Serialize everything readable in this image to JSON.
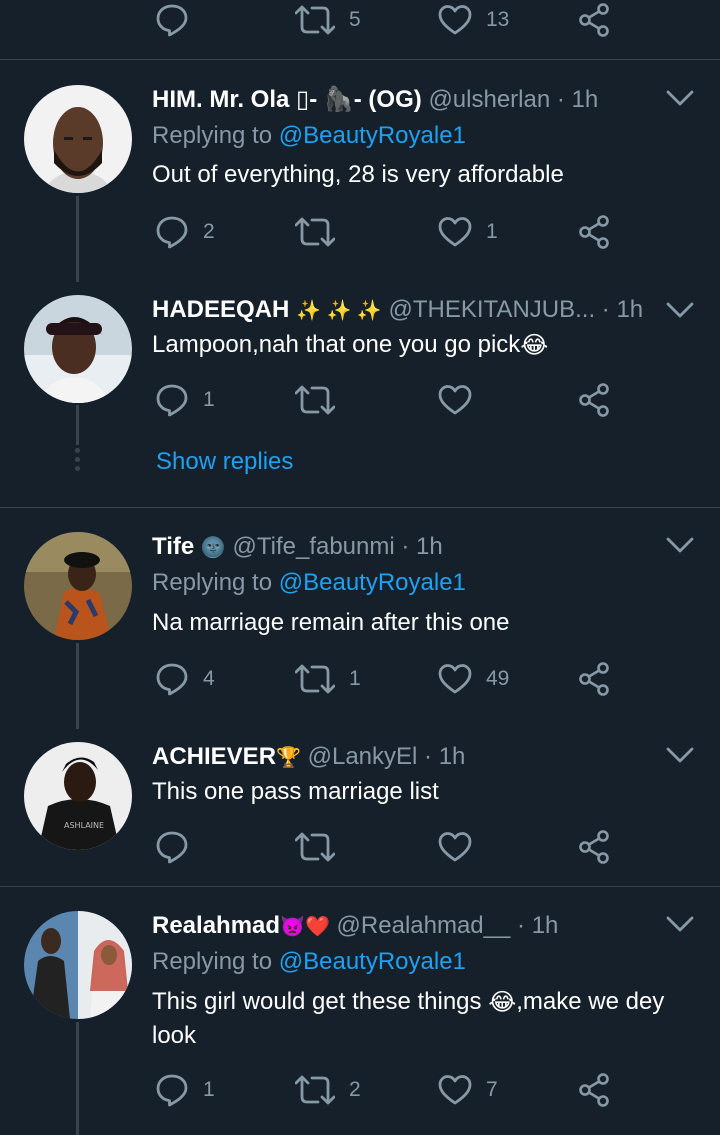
{
  "top_actions": {
    "retweets": "5",
    "likes": "13"
  },
  "tweets": [
    {
      "name": "HIM. Mr. Ola ▯- 🦍- (OG)",
      "handle": "@ulsherlan",
      "time": "· 1h",
      "replying_prefix": "Replying to ",
      "replying_to": "@BeautyRoyale1",
      "text": "Out of everything, 28 is very affordable",
      "replies": "2",
      "retweets": "",
      "likes": "1"
    },
    {
      "name": "HADEEQAH",
      "name_emoji": "✨ ✨ ✨",
      "handle": "@THEKITANJUB...",
      "time": "· 1h",
      "text": "Lampoon,nah that one you go pick",
      "text_emoji": "😂",
      "replies": "1",
      "retweets": "",
      "likes": "",
      "show_replies": "Show replies"
    },
    {
      "name": "Tife",
      "name_emoji": "🌚",
      "handle": "@Tife_fabunmi",
      "time": "· 1h",
      "replying_prefix": "Replying to ",
      "replying_to": "@BeautyRoyale1",
      "text": "Na marriage remain after this one",
      "replies": "4",
      "retweets": "1",
      "likes": "49"
    },
    {
      "name": "ACHIEVER",
      "name_emoji": "🏆",
      "handle": "@LankyEl",
      "time": "· 1h",
      "text": "This one pass marriage list",
      "replies": "",
      "retweets": "",
      "likes": ""
    },
    {
      "name": "Realahmad",
      "name_emoji": "👿❤️",
      "handle": "@Realahmad__",
      "time": "· 1h",
      "replying_prefix": "Replying to ",
      "replying_to": "@BeautyRoyale1",
      "text_a": "This girl would get these things ",
      "text_emoji": "😂",
      "text_b": ",make we dey look",
      "replies": "1",
      "retweets": "2",
      "likes": "7"
    }
  ],
  "colors": {
    "background": "#15202b",
    "secondary": "#8899a6",
    "accent": "#1da1f2",
    "divider": "#38444d"
  }
}
